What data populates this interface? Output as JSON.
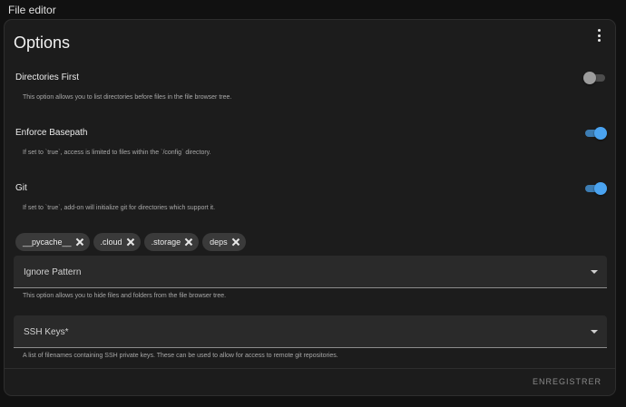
{
  "header": {
    "title": "File editor"
  },
  "card": {
    "title": "Options",
    "options": [
      {
        "label": "Directories First",
        "description": "This option allows you to list directories before files in the file browser tree.",
        "enabled": false
      },
      {
        "label": "Enforce Basepath",
        "description": "If set to `true`, access is limited to files within the `/config` directory.",
        "enabled": true
      },
      {
        "label": "Git",
        "description": "If set to `true`, add-on will initialize git for directories which support it.",
        "enabled": true
      }
    ],
    "chips": [
      "__pycache__",
      ".cloud",
      ".storage",
      "deps"
    ],
    "ignore_pattern": {
      "label": "Ignore Pattern",
      "helper": "This option allows you to hide files and folders from the file browser tree."
    },
    "ssh_keys": {
      "label": "SSH Keys*",
      "helper": "A list of filenames containing SSH private keys. These can be used to allow for access to remote git repositories."
    },
    "save_label": "ENREGISTRER"
  },
  "icons": {
    "menu": "more-vertical-icon",
    "chip_remove": "close-icon",
    "dropdown": "arrow-drop-down-icon"
  },
  "colors": {
    "toggle_on": "#4aa3f0",
    "background": "#111111",
    "card": "#1c1c1c"
  }
}
